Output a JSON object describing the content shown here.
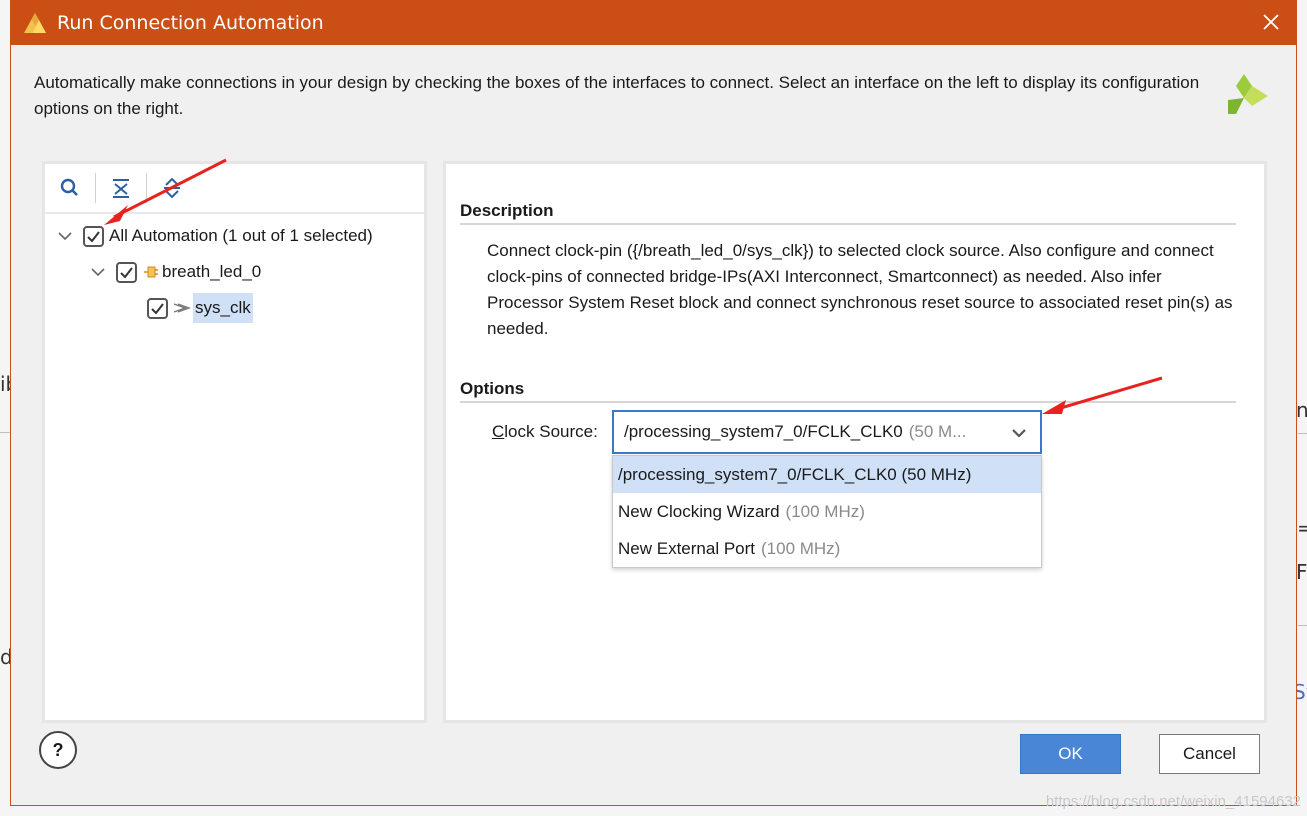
{
  "window": {
    "title": "Run Connection Automation",
    "close_glyph": "✕"
  },
  "intro": "Automatically make connections in your design by checking the boxes of the interfaces to connect. Select an interface on the left to display its configuration options on the right.",
  "tree": {
    "toolbar": [
      "search-icon",
      "collapse-all-icon",
      "expand-all-icon"
    ],
    "items": [
      {
        "label": "All Automation (1 out of 1 selected)",
        "checked": true,
        "expanded": true
      },
      {
        "label": "breath_led_0",
        "checked": true,
        "expanded": true,
        "icon": "ip-block-icon"
      },
      {
        "label": "sys_clk",
        "checked": true,
        "selected": true,
        "icon": "clock-pin-icon"
      }
    ]
  },
  "description": {
    "title": "Description",
    "text": "Connect clock-pin ({/breath_led_0/sys_clk}) to selected clock source. Also configure and connect clock-pins of connected bridge-IPs(AXI Interconnect, Smartconnect) as needed. Also infer Processor System Reset block and connect synchronous reset source to associated reset pin(s) as needed."
  },
  "options": {
    "title": "Options",
    "clock_source_label_first": "C",
    "clock_source_label_rest": "lock Source:",
    "clock_source_value": "/processing_system7_0/FCLK_CLK0",
    "clock_source_value_suffix": "(50 M...",
    "dropdown": [
      {
        "name": "/processing_system7_0/FCLK_CLK0 (50 MHz)",
        "freq": "",
        "selected": true
      },
      {
        "name": "New Clocking Wizard",
        "freq": "(100 MHz)",
        "selected": false
      },
      {
        "name": "New External Port",
        "freq": "(100 MHz)",
        "selected": false
      }
    ]
  },
  "buttons": {
    "help": "?",
    "ok": "OK",
    "cancel": "Cancel"
  },
  "background_fragments": [
    "ib",
    "d",
    "n",
    "=",
    "F",
    "Sy"
  ],
  "watermark": "https://blog.csdn.net/weixin_41594632",
  "colors": {
    "titlebar": "#cb4f15",
    "accent_blue": "#4a86d6",
    "selection": "#cfe0f7",
    "annotation_arrow": "#e8231f"
  }
}
